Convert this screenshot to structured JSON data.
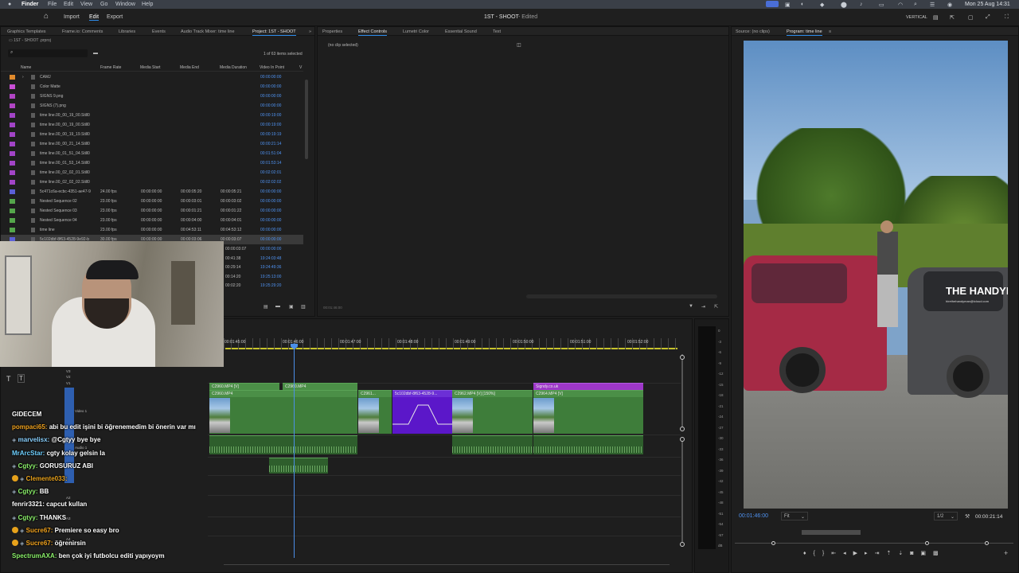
{
  "macbar": {
    "apple": "",
    "app": "Finder",
    "menus": [
      "File",
      "Edit",
      "View",
      "Go",
      "Window",
      "Help"
    ],
    "date": "Mon 25 Aug 14:31"
  },
  "header": {
    "home": "⌂",
    "import": "Import",
    "edit": "Edit",
    "export": "Export",
    "title": "1ST - SHOOT",
    "subtitle": "- Edited",
    "vertical": "VERTICAL"
  },
  "project_tabs": [
    "Graphics Templates",
    "Frame.io: Comments",
    "Libraries",
    "Events",
    "Audio Track Mixer: time line",
    "Project: 1ST - SHOOT"
  ],
  "project": {
    "file": "1ST - SHOOT .prproj",
    "count": "1 of 63 items selected",
    "columns": [
      "Name",
      "Frame Rate",
      "Media Start",
      "Media End",
      "Media Duration",
      "Video In Point",
      "V"
    ],
    "rows": [
      {
        "name": "CAMJ",
        "color": "#e08a2c",
        "fr": "",
        "ms": "",
        "me": "",
        "md": "",
        "vip": "00:00:00:00",
        "bin": true
      },
      {
        "name": "Color Matte",
        "color": "#c94fd6",
        "fr": "",
        "ms": "",
        "me": "",
        "md": "",
        "vip": "00:00:00:00"
      },
      {
        "name": "SIGNS 9.png",
        "color": "#b145c4",
        "fr": "",
        "ms": "",
        "me": "",
        "md": "",
        "vip": "00:00:00:00"
      },
      {
        "name": "SIGNS (7).png",
        "color": "#b145c4",
        "fr": "",
        "ms": "",
        "me": "",
        "md": "",
        "vip": "00:00:00:00"
      },
      {
        "name": "time line.00_00_19_00.Still0",
        "color": "#a244c7",
        "fr": "",
        "ms": "",
        "me": "",
        "md": "",
        "vip": "00:00:19:00"
      },
      {
        "name": "time line.00_00_19_00.Still0",
        "color": "#a244c7",
        "fr": "",
        "ms": "",
        "me": "",
        "md": "",
        "vip": "00:00:19:00"
      },
      {
        "name": "time line.00_00_19_19.Still0",
        "color": "#a244c7",
        "fr": "",
        "ms": "",
        "me": "",
        "md": "",
        "vip": "00:00:19:19"
      },
      {
        "name": "time line.00_00_21_14.Still0",
        "color": "#a244c7",
        "fr": "",
        "ms": "",
        "me": "",
        "md": "",
        "vip": "00:00:21:14"
      },
      {
        "name": "time line.00_01_51_04.Still0",
        "color": "#a244c7",
        "fr": "",
        "ms": "",
        "me": "",
        "md": "",
        "vip": "00:01:51:04"
      },
      {
        "name": "time line.00_01_53_14.Still0",
        "color": "#a244c7",
        "fr": "",
        "ms": "",
        "me": "",
        "md": "",
        "vip": "00:01:53:14"
      },
      {
        "name": "time line.00_02_02_01.Still0",
        "color": "#a244c7",
        "fr": "",
        "ms": "",
        "me": "",
        "md": "",
        "vip": "00:02:02:01"
      },
      {
        "name": "time line.00_02_02_02.Still0",
        "color": "#a244c7",
        "fr": "",
        "ms": "",
        "me": "",
        "md": "",
        "vip": "00:02:02:02"
      },
      {
        "name": "5c471c6a-ecbc-4351-ae47-9",
        "color": "#5b5fd6",
        "fr": "24.00 fps",
        "ms": "00:00:00:00",
        "me": "00:00:05:20",
        "md": "00:00:05:21",
        "vip": "00:00:00:00"
      },
      {
        "name": "Nested Sequence 02",
        "color": "#54a64a",
        "fr": "23.00 fps",
        "ms": "00:00:00:00",
        "me": "00:00:03:01",
        "md": "00:00:03:02",
        "vip": "00:00:00:00"
      },
      {
        "name": "Nested Sequence 03",
        "color": "#54a64a",
        "fr": "23.00 fps",
        "ms": "00:00:00:00",
        "me": "00:00:01:21",
        "md": "00:00:01:22",
        "vip": "00:00:00:00"
      },
      {
        "name": "Nested Sequence 04",
        "color": "#54a64a",
        "fr": "23.00 fps",
        "ms": "00:00:00:00",
        "me": "00:00:04:00",
        "md": "00:00:04:01",
        "vip": "00:00:00:00"
      },
      {
        "name": "time line",
        "color": "#54a64a",
        "fr": "23.00 fps",
        "ms": "00:00:00:00",
        "me": "00:04:53:11",
        "md": "00:04:53:12",
        "vip": "00:00:00:00"
      },
      {
        "name": "5c102dbf-8f63-4528-9e92-b",
        "color": "#5b5fd6",
        "fr": "30.00 fps",
        "ms": "00:00:00:00",
        "me": "00:00:03:06",
        "md": "00:00:03:07",
        "vip": "00:00:00:00",
        "selected": true
      }
    ],
    "extra_rows": [
      {
        "md": "00:00:03:07",
        "vip": "00:00:00:00"
      },
      {
        "md": "00:41:38",
        "vip": "19:24:03:48"
      },
      {
        "md": "00:29:14",
        "vip": "19:24:49:36"
      },
      {
        "md": "00:14:20",
        "vip": "19:25:13:00"
      },
      {
        "md": "00:02:20",
        "vip": "19:25:29:20"
      }
    ]
  },
  "effect_tabs": [
    "Properties",
    "Effect Controls",
    "Lumetri Color",
    "Essential Sound",
    "Text"
  ],
  "effect": {
    "no_clip": "(no clip selected)",
    "tc": "00:01:46:00"
  },
  "program": {
    "source_tab": "Source: (no clips)",
    "program_tab": "Program: time line",
    "timecode": "00:01:46:00",
    "fit": "Fit",
    "quality": "1/2",
    "duration": "00:00:21:14",
    "van_brand": "THE HANDYM",
    "van_sub": "hirethehandyman@icloud.com"
  },
  "timeline": {
    "ruler": [
      "00:01:45:00",
      "00:01:46:00",
      "00:01:47:00",
      "00:01:48:00",
      "00:01:49:00",
      "00:01:50:00",
      "00:01:51:00",
      "00:01:52:00"
    ],
    "tracks": [
      "V3",
      "V2",
      "V1",
      "Video 1",
      "A1",
      "Audio 1",
      "A2",
      "A3",
      "A4"
    ],
    "clips": [
      {
        "label": "C2960.MP4 [V]"
      },
      {
        "label": "C2960.MP4"
      },
      {
        "label": "C2960.MP4"
      },
      {
        "label": "C2961..."
      },
      {
        "label": "5c102dbf-8f63-4528-9..."
      },
      {
        "label": "C2962.MP4 [V] [150%]"
      },
      {
        "label": "C2964.MP4 [V]"
      },
      {
        "label": "Signdy.co.uk"
      }
    ],
    "db_labels": [
      "0",
      "-3",
      "-6",
      "-9",
      "-12",
      "-15",
      "-18",
      "-21",
      "-24",
      "-27",
      "-30",
      "-33",
      "-36",
      "-39",
      "-42",
      "-45",
      "-48",
      "-51",
      "-54",
      "-57",
      "dB"
    ]
  },
  "chat": [
    {
      "user": "",
      "msg": "GIDECEM",
      "ucolor": "#ffffff",
      "badge": false
    },
    {
      "user": "pompaci65:",
      "msg": "abi bu edit işini bi öğrenemedim bi önerin var mı",
      "ucolor": "#f0a21e",
      "badge": false
    },
    {
      "user": "marvelisx:",
      "msg": "@Cgtyy bye bye",
      "ucolor": "#8ad1ff",
      "badge": false,
      "pre": "🛡"
    },
    {
      "user": "MrArcStar:",
      "msg": "cgty kolay gelsin la",
      "ucolor": "#6fd0ff",
      "badge": false
    },
    {
      "user": "Cgtyy:",
      "msg": "GORUSURUZ ABI",
      "ucolor": "#8cf26b",
      "badge": false,
      "pre": "🛡"
    },
    {
      "user": "Clemente033:",
      "msg": "",
      "ucolor": "#e8a21c",
      "badge": true,
      "pre": "🛡"
    },
    {
      "user": "Cgtyy:",
      "msg": "BB",
      "ucolor": "#8cf26b",
      "badge": false,
      "pre": "🛡"
    },
    {
      "user": "fenrir3321:",
      "msg": "capcut kullan",
      "ucolor": "#ffffff",
      "badge": false
    },
    {
      "user": "Cgtyy:",
      "msg": "THANKS",
      "ucolor": "#8cf26b",
      "badge": false,
      "pre": "🛡"
    },
    {
      "user": "Sucre67:",
      "msg": "Premiere so easy bro",
      "ucolor": "#f0a21e",
      "badge": true,
      "pre": "🛡"
    },
    {
      "user": "Sucre67:",
      "msg": "öğrenirsin",
      "ucolor": "#f0a21e",
      "badge": true,
      "pre": "🛡"
    },
    {
      "user": "SpectrumAXA:",
      "msg": "ben çok iyi futbolcu editi yapıyoym",
      "ucolor": "#8cf26b",
      "badge": false
    }
  ],
  "icons": {
    "search": "search-icon",
    "folder": "folder-icon",
    "settings": "gear-icon"
  }
}
